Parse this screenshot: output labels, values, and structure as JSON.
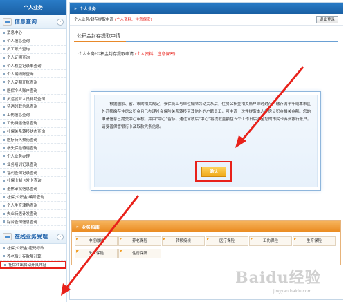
{
  "sidebar": {
    "header": "个人业务",
    "info_section": {
      "title": "信息查询"
    },
    "info_items": [
      "消息中心",
      "个人信息查询",
      "员工账户查询",
      "个人证明查询",
      "个人权益记录单查询",
      "个人明细账查询",
      "个人定期开账查询",
      "医保个人账户查询",
      "灵活就业人员补助查询",
      "待遇领取信息查询",
      "工伤信息查询",
      "工伤待遇信息查询",
      "社保关系转移状态查询",
      "医疗待入预药查询",
      "参失保险待遇查询",
      "个人业务办理",
      "业务培训记录查询",
      "福利查询记录查询",
      "社保卡制卡发卡查询",
      "退休审批信息查询",
      "社保(公积金)编号查询",
      "个人生育津贴查询",
      "失业待遇计发查询",
      "综合查询信息查询"
    ],
    "online_section": {
      "title": "在线业务受理"
    },
    "online_items": [
      "社保(公积金)密码修改",
      "养老后计存款额计算",
      "社保转出启动开具凭证"
    ]
  },
  "main": {
    "header": "个人业务",
    "toolbar": {
      "label": "个人业务/封存提取申请",
      "hint": "(个人资料、注意保密)",
      "exit": "退出登录"
    },
    "title": "公积金封存提取申请",
    "breadcrumb": {
      "label": "个人业务/公积金封存提取申请",
      "hint": "(个人资料、注意保密)"
    },
    "notice": {
      "text": "根据国家、省、市的相关规定，参保员工与单位解除劳动关系后，住房公积金相关账户即时封存。缴存满半年或本市区外迁移缴存住房公积金且已办理社会保险关系转移至其他外的户籍员工，可申请一次性提取本人住房公积金相关金额。您的申请信息已提交中心审核，并由“中心”留存，通过审核后“中心”将提取金额在五个工作日后汇至您的市民卡苏州银行账户。请妥善保管银行卡及取款凭条信息。",
      "confirm": "确认"
    },
    "guide": {
      "title": "业务指南",
      "items": [
        "申报缴纳",
        "养老保险",
        "转移接续",
        "医疗保险",
        "工伤保险",
        "生育保险",
        "失业保险",
        "住房保障"
      ]
    }
  },
  "watermark": {
    "main": "Baidu经验",
    "sub": "jingyan.baidu.com"
  },
  "colors": {
    "primary_blue": "#1a5fa3",
    "accent_orange": "#ea8a1f",
    "annotation_red": "#e8211a"
  }
}
